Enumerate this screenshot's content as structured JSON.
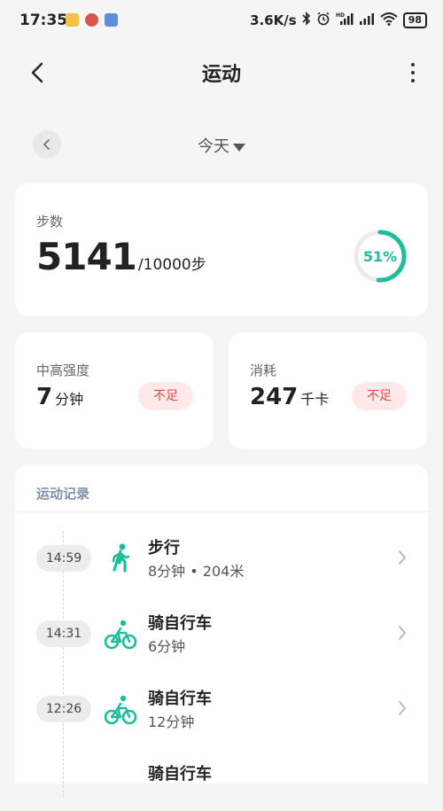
{
  "status_bar": {
    "time": "17:35",
    "network_speed": "3.6K/s",
    "battery": "98",
    "icons": [
      "bluetooth-icon",
      "alarm-icon",
      "hd-signal-icon",
      "signal-icon",
      "wifi-icon",
      "battery-icon"
    ]
  },
  "header": {
    "title": "运动"
  },
  "date_selector": {
    "label": "今天"
  },
  "steps": {
    "label": "步数",
    "value": "5141",
    "goal_text": "/10000步",
    "percent_text": "51%",
    "progress": 0.51,
    "accent_color": "#1cbf9a"
  },
  "intensity": {
    "label": "中高强度",
    "value": "7",
    "unit": "分钟",
    "badge": "不足"
  },
  "calories": {
    "label": "消耗",
    "value": "247",
    "unit": "千卡",
    "badge": "不足"
  },
  "records": {
    "title": "运动记录",
    "items": [
      {
        "time": "14:59",
        "name": "步行",
        "detail": "8分钟 • 204米",
        "icon": "walking-icon"
      },
      {
        "time": "14:31",
        "name": "骑自行车",
        "detail": "6分钟",
        "icon": "cycling-icon"
      },
      {
        "time": "12:26",
        "name": "骑自行车",
        "detail": "12分钟",
        "icon": "cycling-icon"
      },
      {
        "time": "",
        "name": "骑自行车",
        "detail": "",
        "icon": "cycling-icon"
      }
    ]
  }
}
